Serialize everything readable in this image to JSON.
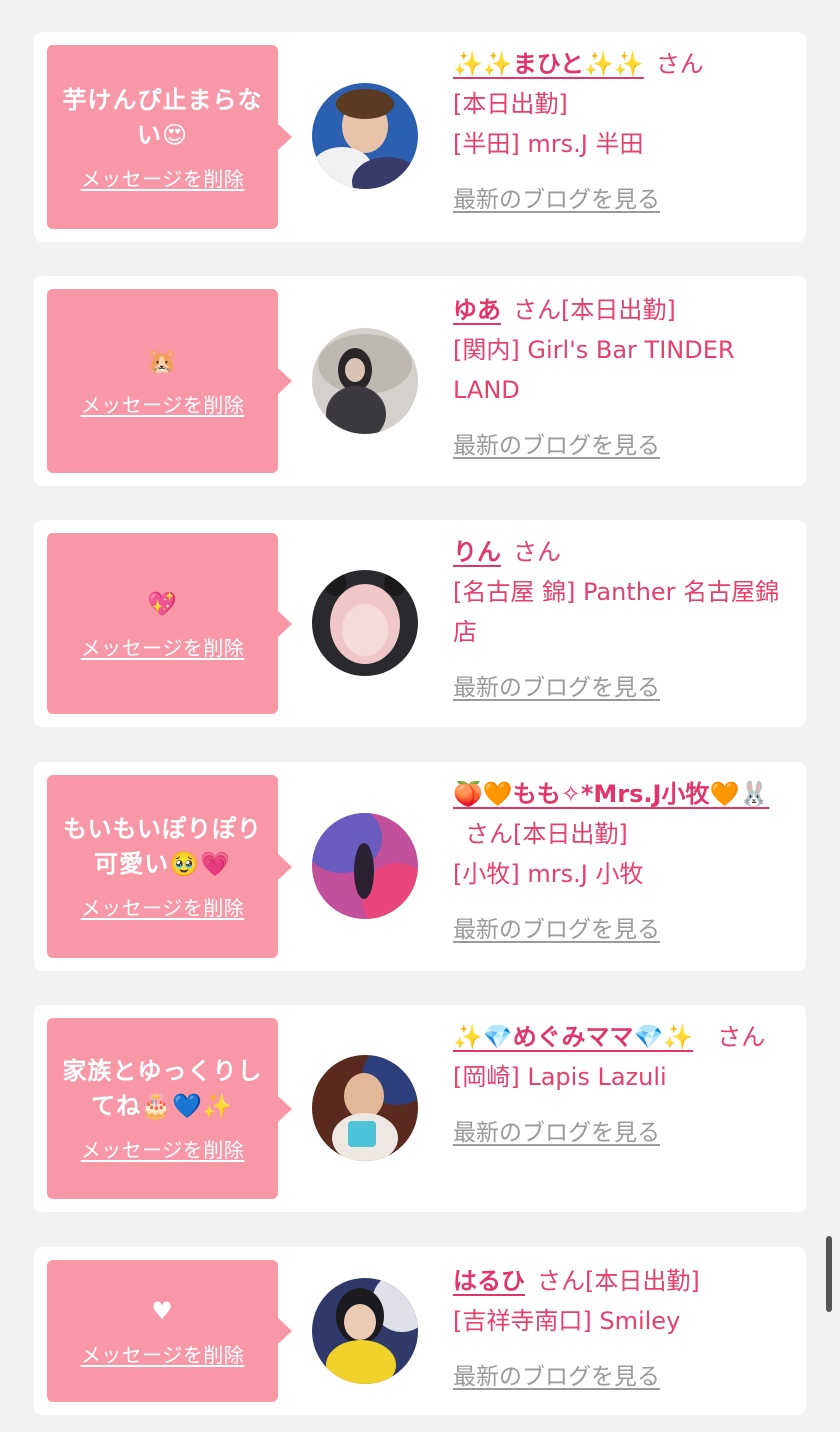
{
  "common": {
    "delete_label": "メッセージを削除",
    "blog_label": "最新のブログを見る"
  },
  "messages": [
    {
      "text": "芋けんぴ止まらない😍",
      "name": "✨✨まひと✨✨",
      "san": "さん",
      "status": "[本日出勤]",
      "shop": "[半田] mrs.J 半田"
    },
    {
      "text": "🐹",
      "name": "ゆあ",
      "san": "さん",
      "status": "[本日出勤]",
      "shop": "[関内] Girl's Bar TINDER LAND"
    },
    {
      "text": "💖",
      "name": "りん",
      "san": "さん",
      "status": "",
      "shop": "[名古屋 錦] Panther 名古屋錦店"
    },
    {
      "text": "もいもいぽりぽり可愛い🥹💗",
      "name": "🍑🧡もも✧*Mrs.J小牧🧡🐰",
      "san": "さん",
      "status": "[本日出勤]",
      "shop": "[小牧] mrs.J 小牧"
    },
    {
      "text": "家族とゆっくりしてね🎂💙✨",
      "name": "✨💎めぐみママ💎✨",
      "san": "さん",
      "status": "",
      "shop": "[岡崎] Lapis Lazuli"
    },
    {
      "text": "♥",
      "name": "はるひ",
      "san": "さん",
      "status": "[本日出勤]",
      "shop": "[吉祥寺南口] Smiley"
    }
  ],
  "colors": {
    "bubble": "#f897a6",
    "accent": "#e2366a",
    "link_gray": "#9a9a9a",
    "page_bg": "#f2f2f2"
  }
}
